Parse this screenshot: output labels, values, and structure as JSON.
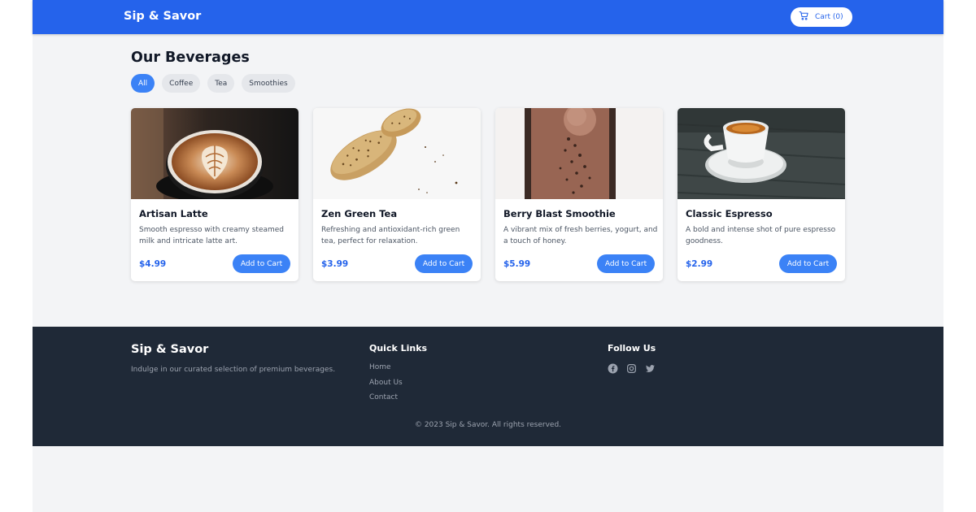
{
  "brand": "Sip & Savor",
  "header": {
    "cart_label": "Cart (0)"
  },
  "main": {
    "title": "Our Beverages",
    "filters": [
      {
        "label": "All",
        "active": true
      },
      {
        "label": "Coffee",
        "active": false
      },
      {
        "label": "Tea",
        "active": false
      },
      {
        "label": "Smoothies",
        "active": false
      }
    ],
    "products": [
      {
        "name": "Artisan Latte",
        "description": "Smooth espresso with creamy steamed milk and intricate latte art.",
        "price": "$4.99",
        "button": "Add to Cart",
        "image": "latte-art-photo"
      },
      {
        "name": "Zen Green Tea",
        "description": "Refreshing and antioxidant-rich green tea, perfect for relaxation.",
        "price": "$3.99",
        "button": "Add to Cart",
        "image": "bread-rolls-photo"
      },
      {
        "name": "Berry Blast Smoothie",
        "description": "A vibrant mix of fresh berries, yogurt, and a touch of honey.",
        "price": "$5.99",
        "button": "Add to Cart",
        "image": "chocolate-drink-photo"
      },
      {
        "name": "Classic Espresso",
        "description": "A bold and intense shot of pure espresso goodness.",
        "price": "$2.99",
        "button": "Add to Cart",
        "image": "espresso-cup-photo"
      }
    ]
  },
  "footer": {
    "brand": "Sip & Savor",
    "tagline": "Indulge in our curated selection of premium beverages.",
    "quick_links_title": "Quick Links",
    "quick_links": [
      "Home",
      "About Us",
      "Contact"
    ],
    "follow_title": "Follow Us",
    "social": [
      "facebook-icon",
      "instagram-icon",
      "twitter-icon"
    ],
    "copyright": "© 2023 Sip & Savor. All rights reserved."
  },
  "colors": {
    "primary": "#2563eb",
    "button": "#3b82f6",
    "background": "#f3f4f6",
    "footer": "#1f2937"
  }
}
